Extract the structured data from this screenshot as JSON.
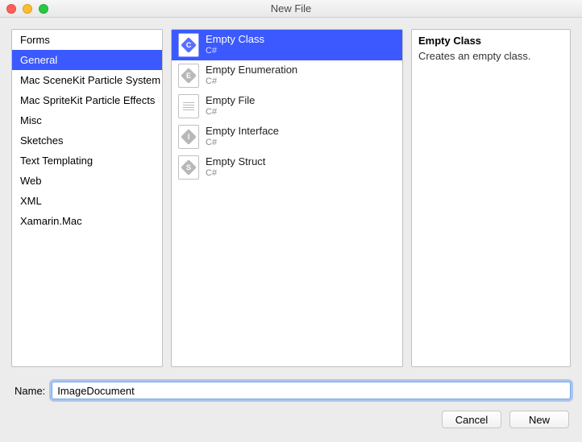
{
  "window": {
    "title": "New File"
  },
  "categories": [
    {
      "label": "Forms",
      "selected": false
    },
    {
      "label": "General",
      "selected": true
    },
    {
      "label": "Mac SceneKit Particle System",
      "selected": false
    },
    {
      "label": "Mac SpriteKit Particle Effects",
      "selected": false
    },
    {
      "label": "Misc",
      "selected": false
    },
    {
      "label": "Sketches",
      "selected": false
    },
    {
      "label": "Text Templating",
      "selected": false
    },
    {
      "label": "Web",
      "selected": false
    },
    {
      "label": "XML",
      "selected": false
    },
    {
      "label": "Xamarin.Mac",
      "selected": false
    }
  ],
  "templates": [
    {
      "label": "Empty Class",
      "lang": "C#",
      "glyph": "C",
      "selected": true
    },
    {
      "label": "Empty Enumeration",
      "lang": "C#",
      "glyph": "E",
      "selected": false
    },
    {
      "label": "Empty File",
      "lang": "C#",
      "glyph": "file",
      "selected": false
    },
    {
      "label": "Empty Interface",
      "lang": "C#",
      "glyph": "I",
      "selected": false
    },
    {
      "label": "Empty Struct",
      "lang": "C#",
      "glyph": "S",
      "selected": false
    }
  ],
  "details": {
    "title": "Empty Class",
    "description": "Creates an empty class."
  },
  "nameField": {
    "label": "Name:",
    "value": "ImageDocument"
  },
  "buttons": {
    "cancel": "Cancel",
    "new": "New"
  }
}
